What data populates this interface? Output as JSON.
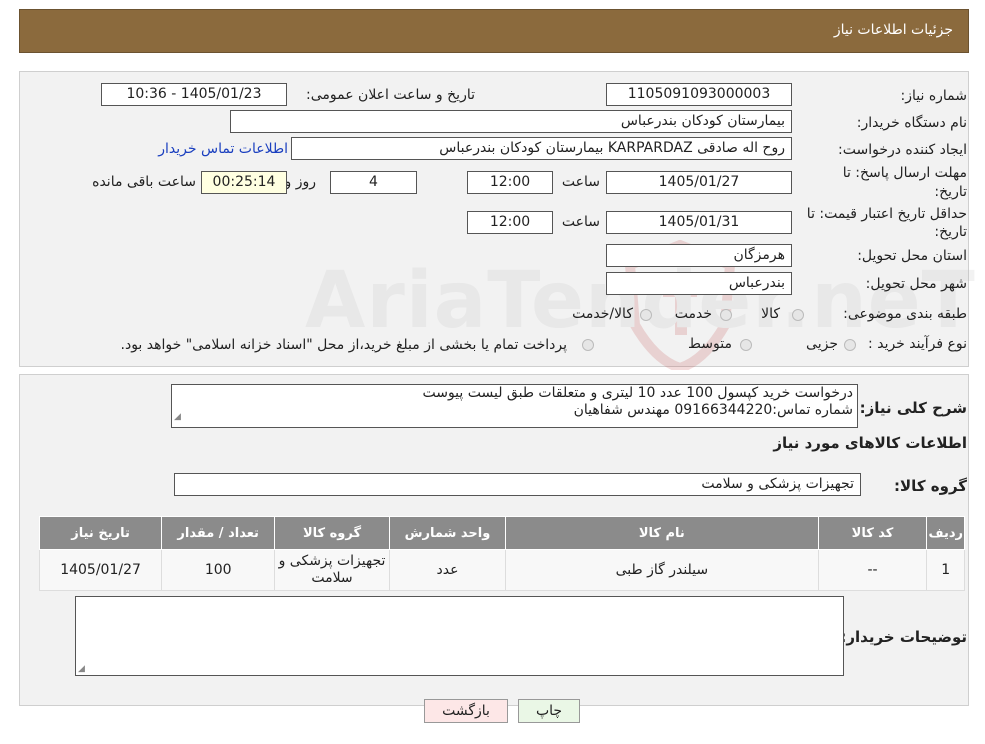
{
  "header": {
    "title": "جزئیات اطلاعات نیاز"
  },
  "need_info": {
    "need_number_label": "شماره نیاز:",
    "need_number": "1105091093000003",
    "announce_label": "تاریخ و ساعت اعلان عمومی:",
    "announce_value": "1405/01/23 - 10:36",
    "buyer_org_label": "نام دستگاه خریدار:",
    "buyer_org": "بیمارستان کودکان بندرعباس",
    "creator_label": "ایجاد کننده درخواست:",
    "creator": "روح اله صادقی KARPARDAZ بیمارستان کودکان بندرعباس",
    "contact_link": "اطلاعات تماس خریدار",
    "deadline_label_1": "مهلت ارسال پاسخ: تا",
    "deadline_label_2": "تاریخ:",
    "deadline_date": "1405/01/27",
    "hour_label": "ساعت",
    "deadline_time": "12:00",
    "days": "4",
    "days_label": "روز و",
    "remaining": "00:25:14",
    "remaining_label": "ساعت باقی مانده",
    "validity_label_1": "حداقل تاریخ اعتبار قیمت: تا",
    "validity_label_2": "تاریخ:",
    "validity_date": "1405/01/31",
    "validity_time": "12:00",
    "province_label": "استان محل تحویل:",
    "province": "هرمزگان",
    "city_label": "شهر محل تحویل:",
    "city": "بندرعباس",
    "category_label": "طبقه بندی موضوعی:",
    "category_options": [
      "کالا",
      "خدمت",
      "کالا/خدمت"
    ],
    "process_label": "نوع فرآیند خرید :",
    "process_options": [
      "جزیی",
      "متوسط"
    ],
    "process_note": "پرداخت تمام یا بخشی از مبلغ خرید،از محل \"اسناد خزانه اسلامی\" خواهد بود."
  },
  "description": {
    "label": "شرح کلی نیاز:",
    "line1": "درخواست خرید کپسول 100 عدد 10 لیتری و متعلقات طبق لیست پیوست",
    "line2": "شماره تماس:09166344220 مهندس شفاهیان"
  },
  "goods": {
    "section_title": "اطلاعات کالاهای مورد نیاز",
    "group_label": "گروه کالا:",
    "group_value": "تجهیزات پزشکی و سلامت",
    "columns": [
      "ردیف",
      "کد کالا",
      "نام کالا",
      "واحد شمارش",
      "گروه کالا",
      "تعداد / مقدار",
      "تاریخ نیاز"
    ],
    "rows": [
      [
        "1",
        "--",
        "سیلندر گاز طبی",
        "عدد",
        "تجهیزات پزشکی و سلامت",
        "100",
        "1405/01/27"
      ]
    ]
  },
  "buyer_notes": {
    "label": "توضیحات خریدار:",
    "value": ""
  },
  "buttons": {
    "print": "چاپ",
    "back": "بازگشت"
  },
  "watermark": {
    "text": "AriaTender.neT"
  },
  "colors": {
    "header": "#8b6a3d",
    "table_header": "#8b8b8b",
    "back_button": "#fde7e7",
    "print_button": "#eaf7e6"
  }
}
